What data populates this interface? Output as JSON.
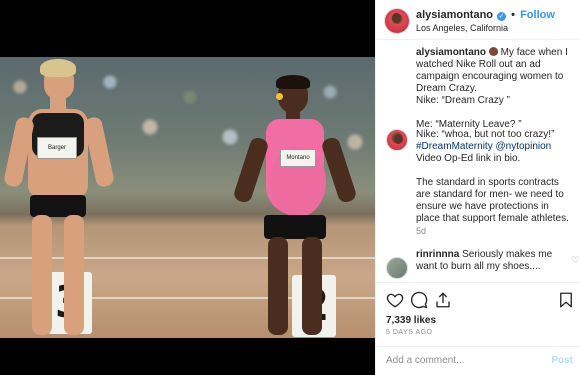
{
  "post": {
    "username": "alysiamontano",
    "location": "Los Angeles, California",
    "follow_label": "Follow",
    "dot": "•"
  },
  "caption": {
    "username": "alysiamontano",
    "lines": "My face when I watched Nike Roll out an ad campaign encouraging women to Dream Crazy.\nNike: “Dream Crazy ”\n\nMe: “Maternity Leave? ”"
  },
  "comment2": {
    "pre": "Nike: “whoa, but not too crazy!” ",
    "hashtag": "#DreamMaternity",
    "mention": "@nytopinion",
    "post": " Video Op-Ed link in bio.\n\nThe standard in sports contracts are standard for men- we need to ensure we have protections in place that support female athletes.",
    "time": "5d"
  },
  "comment3": {
    "username": "rinrinnna",
    "text": "Seriously makes me want to burn all my shoes...."
  },
  "engagement": {
    "likes": "7,339 likes",
    "date": "5 DAYS AGO"
  },
  "add_comment": {
    "placeholder": "Add a comment...",
    "post_label": "Post"
  },
  "photo": {
    "bib_left": "Barger",
    "bib_right": "Montano",
    "block_left": "3",
    "block_right": "2"
  },
  "icons": {
    "like": "heart-icon",
    "comment": "comment-icon",
    "share": "share-icon",
    "save": "bookmark-icon"
  },
  "colors": {
    "link_blue": "#3897f0",
    "tag_blue": "#003569",
    "muted": "#8e8e8e",
    "top_pink": "#f06ea3",
    "top_black": "#111111"
  }
}
